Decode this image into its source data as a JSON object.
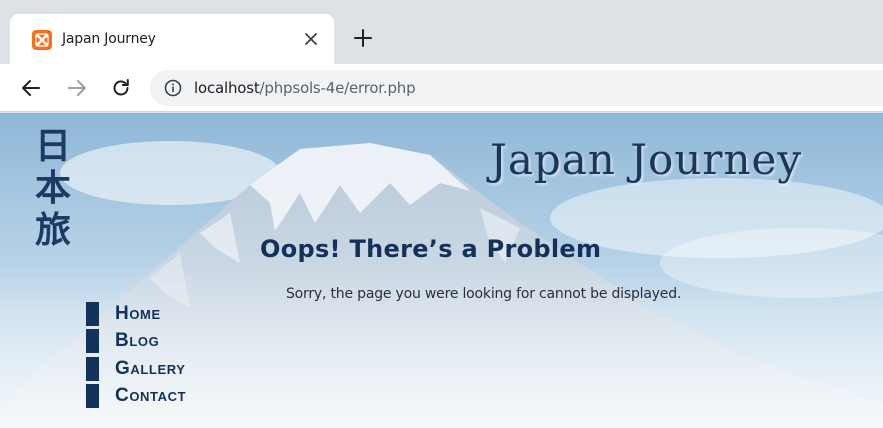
{
  "browser": {
    "tab": {
      "title": "Japan Journey",
      "favicon": "xampp-icon",
      "close_icon": "close-icon"
    },
    "new_tab_icon": "plus-icon",
    "toolbar": {
      "back_icon": "arrow-left-icon",
      "forward_icon": "arrow-right-icon",
      "reload_icon": "reload-icon",
      "info_icon": "info-icon"
    },
    "address": {
      "host": "localhost",
      "path": "/phpsols-4e/error.php"
    }
  },
  "page": {
    "logo_kanji": [
      "日",
      "本",
      "旅"
    ],
    "site_title": "Japan Journey",
    "heading": "Oops! There’s a Problem",
    "message": "Sorry, the page you were looking for cannot be displayed.",
    "nav": [
      {
        "label": "Home"
      },
      {
        "label": "Blog"
      },
      {
        "label": "Gallery"
      },
      {
        "label": "Contact"
      }
    ]
  },
  "colors": {
    "nav": "#13325a",
    "heading": "#14315a",
    "favicon": "#f7701f"
  }
}
